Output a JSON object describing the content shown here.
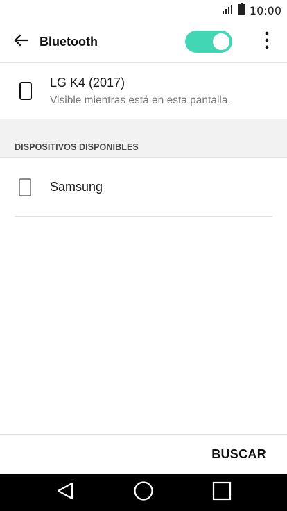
{
  "status_bar": {
    "time": "10:00",
    "signal_icon": "signal-icon",
    "battery_icon": "battery-icon"
  },
  "app_bar": {
    "title": "Bluetooth",
    "back_icon": "arrow-back-icon",
    "toggle_state": "on",
    "overflow_icon": "more-vert-icon"
  },
  "this_device": {
    "name": "LG K4 (2017)",
    "subtitle": "Visible mientras está en esta pantalla.",
    "icon": "phone-icon"
  },
  "available": {
    "header": "DISPOSITIVOS DISPONIBLES",
    "items": [
      {
        "label": "Samsung",
        "icon": "phone-icon"
      }
    ]
  },
  "actions": {
    "scan_label": "BUSCAR"
  },
  "nav_bar": {
    "back_icon": "nav-back-icon",
    "home_icon": "nav-home-icon",
    "recents_icon": "nav-recents-icon"
  },
  "colors": {
    "accent": "#43d6b5",
    "section_bg": "#f2f2f2",
    "nav_bg": "#000000"
  }
}
